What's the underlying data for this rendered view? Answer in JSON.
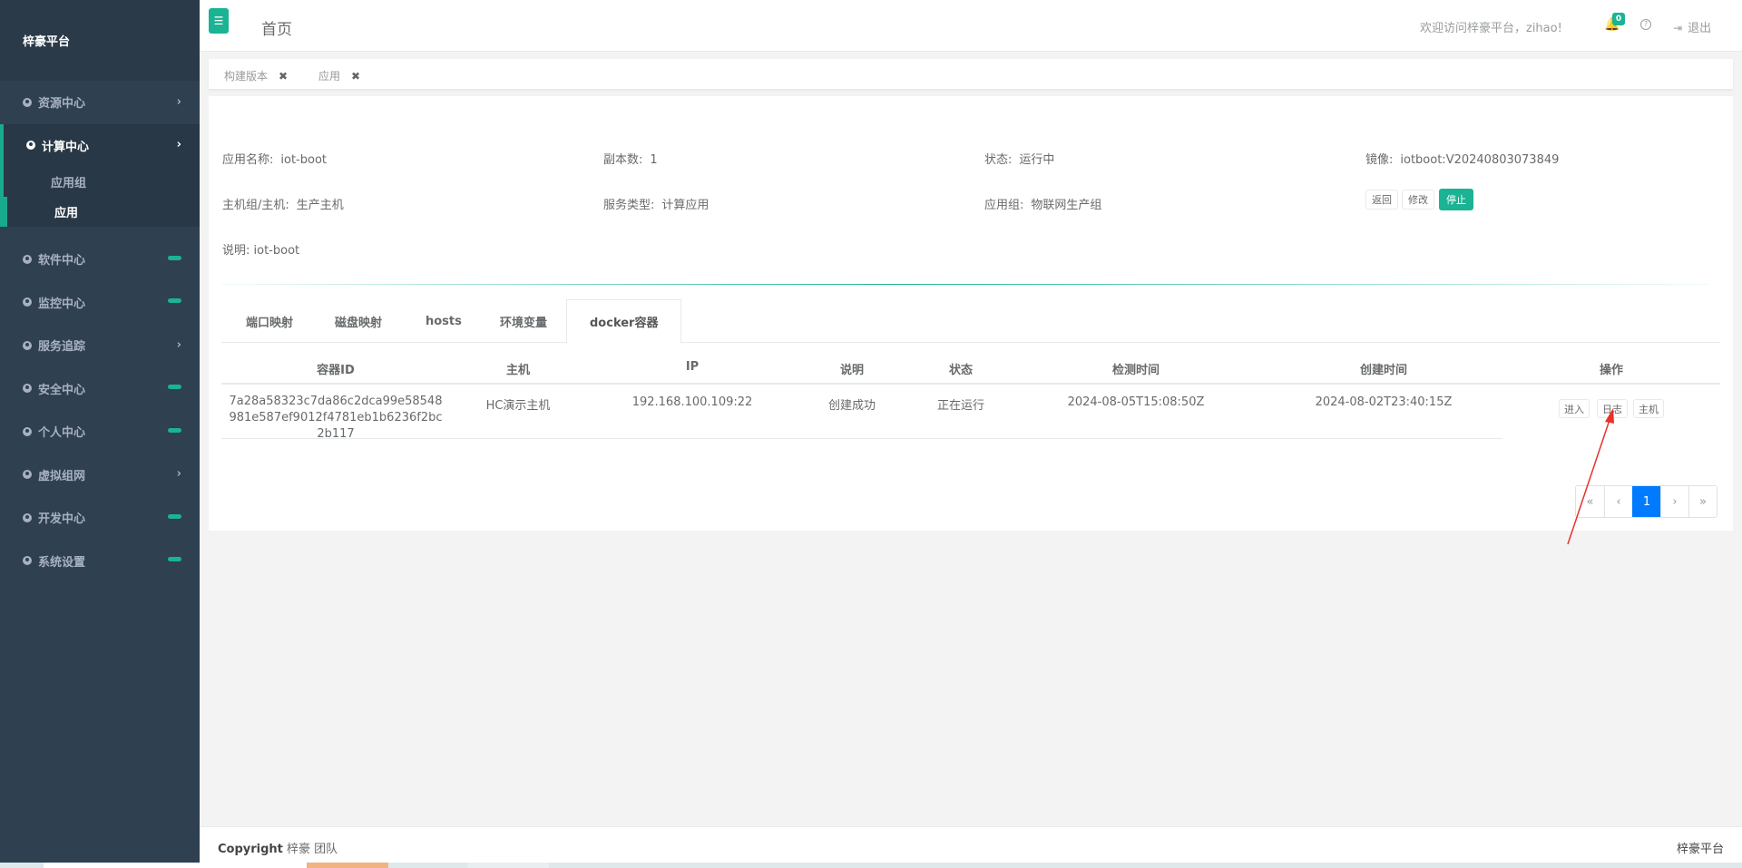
{
  "brand": "梓豪平台",
  "sidebar": {
    "items": [
      {
        "label": "资源中心",
        "marker": "chevron"
      },
      {
        "label": "计算中心",
        "marker": "chevron",
        "active": true,
        "children": [
          {
            "label": "应用组"
          },
          {
            "label": "应用",
            "active": true
          }
        ]
      },
      {
        "label": "软件中心",
        "marker": "bar"
      },
      {
        "label": "监控中心",
        "marker": "bar"
      },
      {
        "label": "服务追踪",
        "marker": "chevron"
      },
      {
        "label": "安全中心",
        "marker": "bar"
      },
      {
        "label": "个人中心",
        "marker": "bar"
      },
      {
        "label": "虚拟组网",
        "marker": "chevron"
      },
      {
        "label": "开发中心",
        "marker": "bar"
      },
      {
        "label": "系统设置",
        "marker": "bar"
      }
    ]
  },
  "header": {
    "title": "首页",
    "welcome": "欢迎访问梓豪平台，zihao!",
    "notification_count": "0",
    "help_glyph": "?",
    "logout": "退出"
  },
  "page_tabs": [
    {
      "label": "构建版本",
      "close": "✖"
    },
    {
      "label": "应用",
      "close": "✖"
    }
  ],
  "app_info": {
    "name_label": "应用名称:",
    "name_value": "iot-boot",
    "replicas_label": "副本数:",
    "replicas_value": "1",
    "status_label": "状态:",
    "status_value": "运行中",
    "image_label": "镜像:",
    "image_value": "iotboot:V20240803073849",
    "host_label": "主机组/主机:",
    "host_value": "生产主机",
    "service_type_label": "服务类型:",
    "service_type_value": "计算应用",
    "group_label": "应用组:",
    "group_value": "物联网生产组",
    "desc": "说明: iot-boot"
  },
  "actions": {
    "back": "返回",
    "edit": "修改",
    "stop": "停止"
  },
  "detail_tabs": [
    "端口映射",
    "磁盘映射",
    "hosts",
    "环境变量",
    "docker容器"
  ],
  "table": {
    "columns": [
      "容器ID",
      "主机",
      "IP",
      "说明",
      "状态",
      "检测时间",
      "创建时间",
      "操作"
    ],
    "rows": [
      {
        "container_id": "7a28a58323c7da86c2dca99e58548981e587ef9012f4781eb1b6236f2bc2b117",
        "host": "HC演示主机",
        "ip": "192.168.100.109:22",
        "desc": "创建成功",
        "status": "正在运行",
        "checked_at": "2024-08-05T15:08:50Z",
        "created_at": "2024-08-02T23:40:15Z",
        "ops": [
          "进入",
          "日志",
          "主机"
        ]
      }
    ]
  },
  "pagination": {
    "first": "«",
    "prev": "‹",
    "current": "1",
    "next": "›",
    "last": "»"
  },
  "footer": {
    "copyright_bold": "Copyright",
    "copyright_rest": "梓豪 团队",
    "right": "梓豪平台"
  },
  "colors": {
    "accent": "#1ab394",
    "sidebar": "#2f4050",
    "pager_active": "#007bff",
    "annotation_arrow": "#e8322b"
  }
}
